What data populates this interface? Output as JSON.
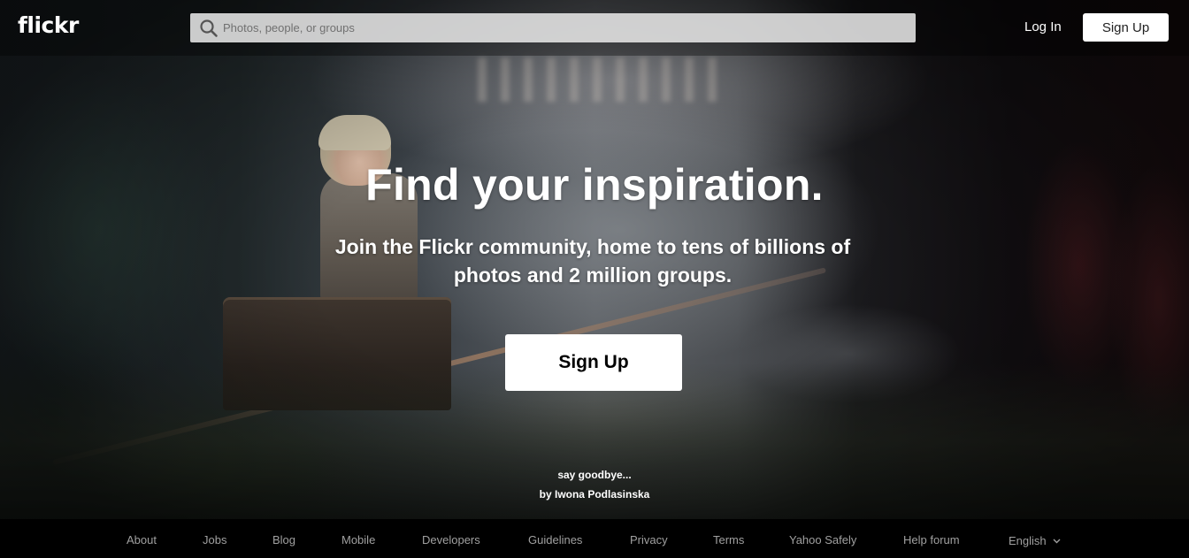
{
  "header": {
    "logo": "flickr",
    "search": {
      "placeholder": "Photos, people, or groups",
      "value": "",
      "icon": "search-icon"
    },
    "login_label": "Log In",
    "signup_label": "Sign Up"
  },
  "hero": {
    "headline": "Find your inspiration.",
    "subhead": "Join the Flickr community, home to tens of billions of photos and 2 million groups.",
    "cta_label": "Sign Up",
    "photo_credit": {
      "title": "say goodbye...",
      "author": "by Iwona Podlasinska"
    }
  },
  "footer": {
    "links": [
      {
        "label": "About"
      },
      {
        "label": "Jobs"
      },
      {
        "label": "Blog"
      },
      {
        "label": "Mobile"
      },
      {
        "label": "Developers"
      },
      {
        "label": "Guidelines"
      },
      {
        "label": "Privacy"
      },
      {
        "label": "Terms"
      },
      {
        "label": "Yahoo Safely"
      },
      {
        "label": "Help forum"
      }
    ],
    "language": {
      "label": "English",
      "icon": "chevron-down-icon"
    }
  },
  "colors": {
    "header_overlay": "#000000",
    "button_bg": "#ffffff",
    "button_text": "#222222",
    "footer_bg": "#000000",
    "footer_link": "#a0a0a0"
  }
}
